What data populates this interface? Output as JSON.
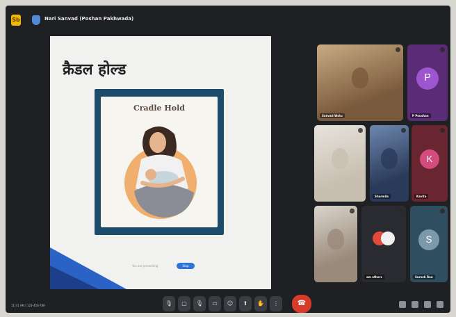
{
  "window": {
    "app_icon": "Sb",
    "meeting_title": "Nari Sanvad (Poshan Pakhwada)"
  },
  "slide": {
    "title": "क्रैडल होल्ड",
    "illustration_title": "Cradle Hold",
    "presenting_text": "You are presenting",
    "stop_button": "Stop"
  },
  "participants": [
    {
      "name": "Sanvad Watu",
      "type": "video",
      "colors": [
        "#7a5a3c",
        "#c9ab84"
      ]
    },
    {
      "name": "P Poushan",
      "type": "avatar",
      "initial": "P",
      "bg": "#5b2c76",
      "circle": "#9d55d0"
    },
    {
      "name": "",
      "type": "video",
      "colors": [
        "#c8bfb0",
        "#e7e3dd"
      ]
    },
    {
      "name": "Sharmila",
      "type": "video",
      "colors": [
        "#2a3a5a",
        "#6d87ad"
      ]
    },
    {
      "name": "Kavita",
      "type": "avatar",
      "initial": "K",
      "bg": "#6a2630",
      "circle": "#d34c7c"
    },
    {
      "name": "",
      "type": "video",
      "colors": [
        "#9a8a7a",
        "#d9d4cc"
      ]
    },
    {
      "name": "am others",
      "type": "others"
    },
    {
      "name": "Suresh Rao",
      "type": "avatar",
      "initial": "S",
      "bg": "#2f4e60",
      "circle": "#7c99aa"
    }
  ],
  "bottom": {
    "time": "11:41 AM",
    "meeting_code": "123-456-789"
  },
  "controls": [
    "mic-icon",
    "camera-icon",
    "mic-icon",
    "camera-icon",
    "captions-icon",
    "emoji-icon",
    "present-icon",
    "raise-hand-icon",
    "more-icon",
    "end-call-icon"
  ],
  "colors": {
    "end_call": "#d93b2b",
    "accent": "#2f72d8"
  }
}
